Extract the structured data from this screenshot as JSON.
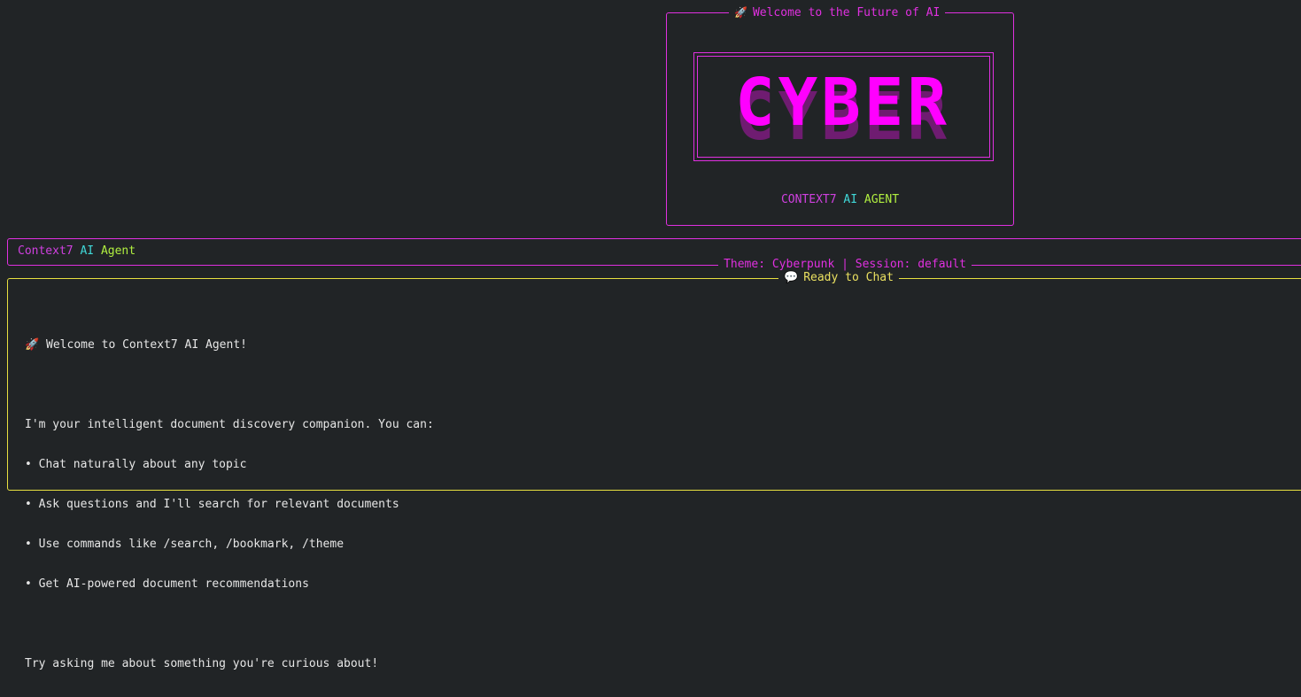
{
  "welcome_panel": {
    "title_icon": "rocket",
    "title": "Welcome to the Future of AI",
    "logo_text": "CYBER",
    "subtitle": {
      "part1": "CONTEXT7",
      "part2": "AI",
      "part3": "AGENT"
    }
  },
  "header": {
    "app_name_part1": "Context7",
    "app_name_part2": "AI",
    "app_name_part3": "Agent",
    "status": "Theme: Cyberpunk | Session: default"
  },
  "chat": {
    "title_icon": "speech-bubble",
    "title": "Ready to Chat",
    "message": {
      "greeting": "🚀 Welcome to Context7 AI Agent!",
      "intro": "I'm your intelligent document discovery companion. You can:",
      "bullets": [
        "• Chat naturally about any topic",
        "• Ask questions and I'll search for relevant documents",
        "• Use commands like /search, /bookmark, /theme",
        "• Get AI-powered document recommendations"
      ],
      "closing": "Try asking me about something you're curious about!"
    }
  },
  "colors": {
    "background": "#212426",
    "accent_magenta": "#e030e0",
    "logo_magenta": "#ff00ff",
    "chat_border_yellow": "#e8e040",
    "cyan": "#40d8d8",
    "lime": "#b0ee40"
  }
}
